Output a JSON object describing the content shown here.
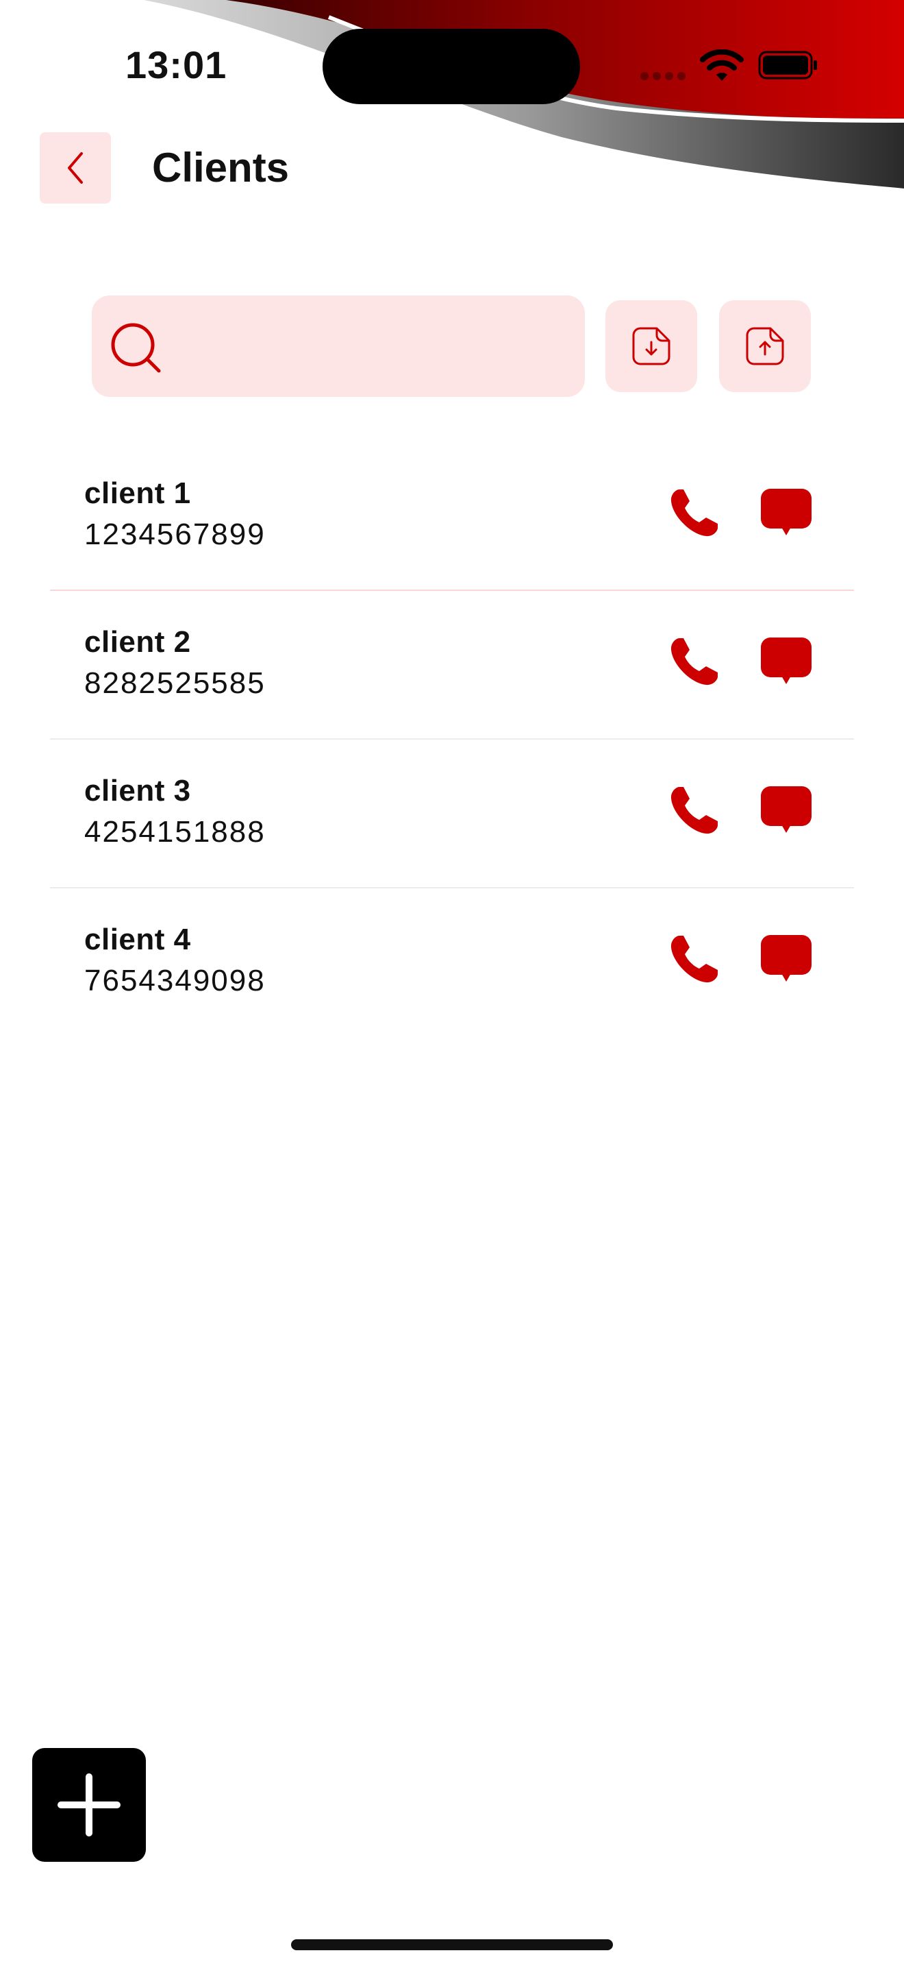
{
  "status_bar": {
    "time": "13:01"
  },
  "header": {
    "title": "Clients"
  },
  "search": {
    "placeholder": "",
    "value": ""
  },
  "theme": {
    "accent": "#cc0000",
    "accent_soft": "#fde5e5"
  },
  "icons": {
    "back": "chevron-left-icon",
    "search": "search-icon",
    "import": "file-download-icon",
    "export": "file-upload-icon",
    "call": "phone-icon",
    "message": "message-bubble-icon",
    "add": "plus-icon"
  },
  "clients": [
    {
      "name": "client 1",
      "phone": "1234567899"
    },
    {
      "name": "client 2",
      "phone": "8282525585"
    },
    {
      "name": "client 3",
      "phone": "4254151888"
    },
    {
      "name": "client 4",
      "phone": "7654349098"
    }
  ]
}
